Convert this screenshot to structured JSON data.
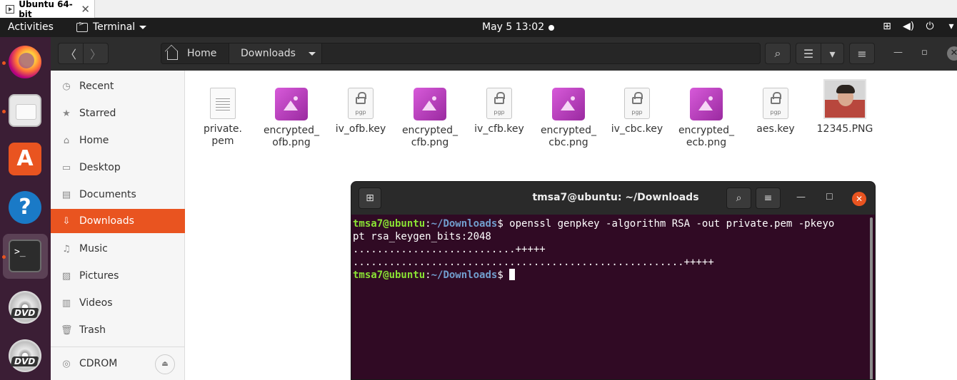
{
  "vm_tab": {
    "title": "Ubuntu 64-bit",
    "close": "✕"
  },
  "topbar": {
    "activities": "Activities",
    "app_name": "Terminal",
    "clock": "May 5  13:02",
    "tray_icons": [
      "network-icon",
      "volume-icon",
      "power-icon",
      "chevron-down-icon"
    ]
  },
  "dock": {
    "items": [
      "firefox",
      "files",
      "ubuntu-software",
      "help",
      "terminal",
      "dvd",
      "dvd"
    ]
  },
  "nautilus": {
    "path": {
      "home": "Home",
      "current": "Downloads"
    },
    "sidebar": [
      {
        "label": "Recent",
        "icon": "recent-icon"
      },
      {
        "label": "Starred",
        "icon": "star-icon"
      },
      {
        "label": "Home",
        "icon": "home-icon"
      },
      {
        "label": "Desktop",
        "icon": "desktop-icon"
      },
      {
        "label": "Documents",
        "icon": "documents-icon"
      },
      {
        "label": "Downloads",
        "icon": "downloads-icon",
        "active": true
      },
      {
        "label": "Music",
        "icon": "music-icon"
      },
      {
        "label": "Pictures",
        "icon": "pictures-icon"
      },
      {
        "label": "Videos",
        "icon": "videos-icon"
      },
      {
        "label": "Trash",
        "icon": "trash-icon"
      },
      {
        "label": "CDROM",
        "icon": "cdrom-icon"
      }
    ],
    "files": [
      {
        "line1": "private.",
        "line2": "pem",
        "type": "text"
      },
      {
        "line1": "encrypted_",
        "line2": "ofb.png",
        "type": "image"
      },
      {
        "line1": "iv_ofb.key",
        "line2": "",
        "type": "key"
      },
      {
        "line1": "encrypted_",
        "line2": "cfb.png",
        "type": "image"
      },
      {
        "line1": "iv_cfb.key",
        "line2": "",
        "type": "key"
      },
      {
        "line1": "encrypted_",
        "line2": "cbc.png",
        "type": "image"
      },
      {
        "line1": "iv_cbc.key",
        "line2": "",
        "type": "key"
      },
      {
        "line1": "encrypted_",
        "line2": "ecb.png",
        "type": "image"
      },
      {
        "line1": "aes.key",
        "line2": "",
        "type": "key"
      },
      {
        "line1": "12345.PNG",
        "line2": "",
        "type": "photo"
      }
    ],
    "key_badge": "pgp"
  },
  "terminal": {
    "title": "tmsa7@ubuntu: ~/Downloads",
    "prompt_user": "tmsa7@ubuntu",
    "prompt_sep": ":",
    "prompt_path": "~/Downloads",
    "prompt_sign": "$ ",
    "command_line1": "openssl genpkey -algorithm RSA -out private.pem -pkeyo",
    "command_line2": "pt rsa_keygen_bits:2048",
    "output_line1": "...........................+++++",
    "output_line2": ".......................................................+++++"
  }
}
